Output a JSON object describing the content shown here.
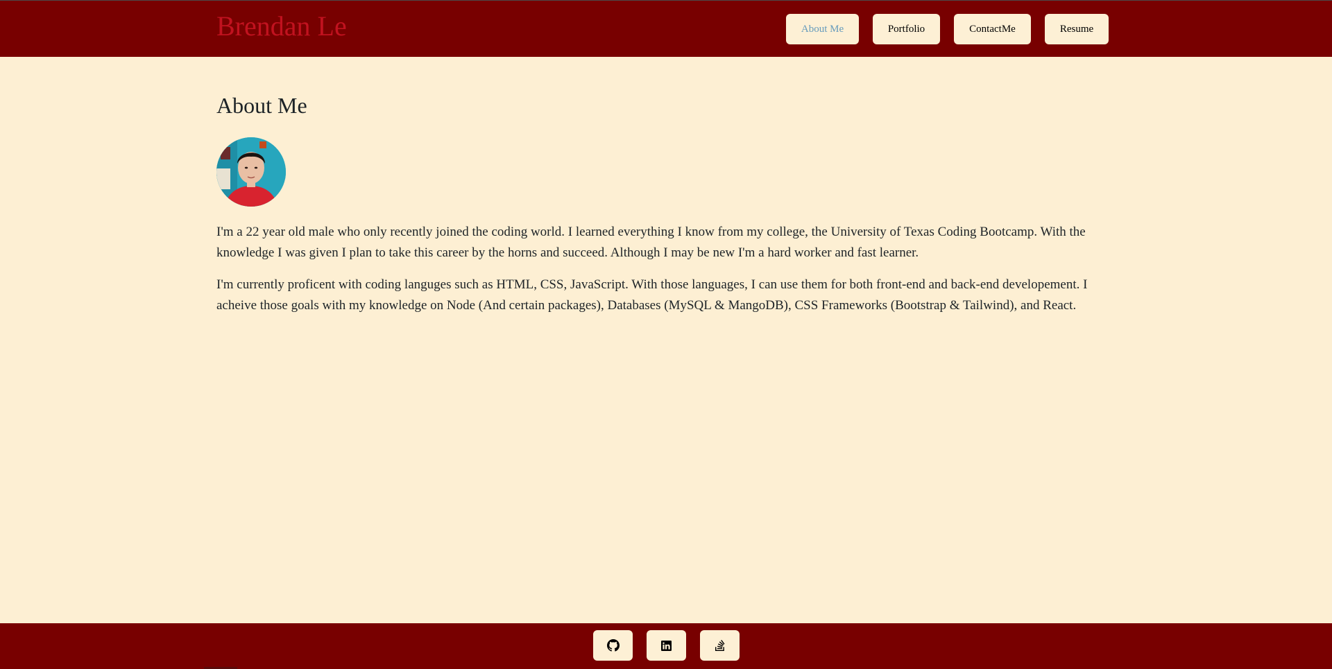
{
  "brand": {
    "name": "Brendan Le",
    "color": "#c1121f"
  },
  "nav": {
    "items": [
      {
        "label": "About Me",
        "active": true
      },
      {
        "label": "Portfolio",
        "active": false
      },
      {
        "label": "ContactMe",
        "active": false
      },
      {
        "label": "Resume",
        "active": false
      }
    ]
  },
  "main": {
    "title": "About Me",
    "avatar": "profile-photo",
    "paragraphs": [
      "I'm a 22 year old male who only recently joined the coding world. I learned everything I know from my college, the University of Texas Coding Bootcamp. With the knowledge I was given I plan to take this career by the horns and succeed. Although I may be new I'm a hard worker and fast learner.",
      "I'm currently proficent with coding languges such as HTML, CSS, JavaScript. With those languages, I can use them for both front-end and back-end developement. I acheive those goals with my knowledge on Node (And certain packages), Databases (MySQL & MangoDB), CSS Frameworks (Bootstrap & Tailwind), and React."
    ]
  },
  "footer": {
    "links": [
      {
        "icon": "github-icon"
      },
      {
        "icon": "linkedin-icon"
      },
      {
        "icon": "stack-overflow-icon"
      }
    ]
  },
  "colors": {
    "header_bg": "#780000",
    "page_bg": "#fdefd3",
    "button_bg": "#fdf0d5",
    "active_link": "#669bbc",
    "text": "#1d2327"
  }
}
